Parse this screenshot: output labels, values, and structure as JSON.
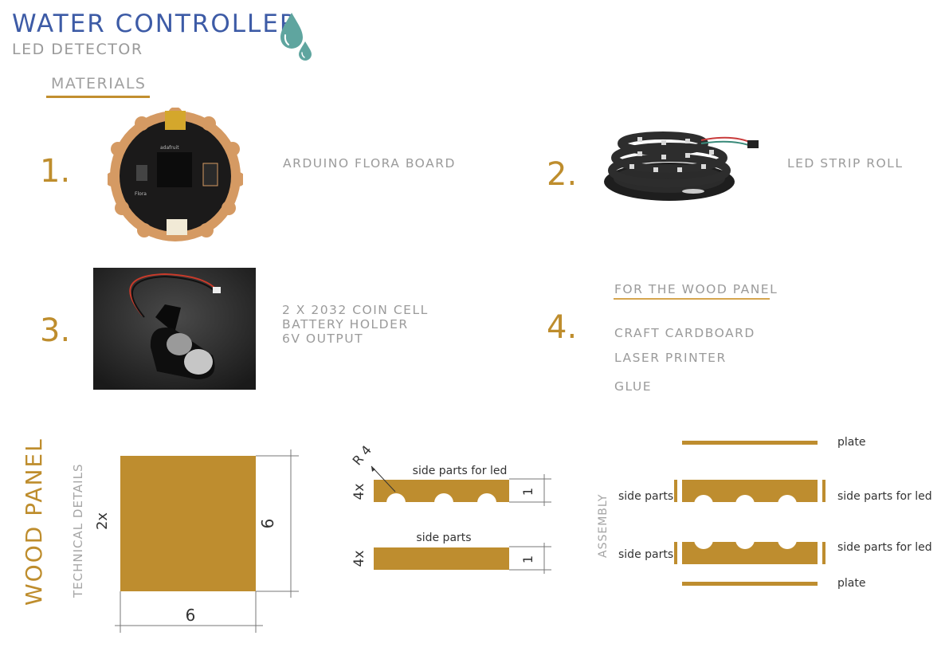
{
  "header": {
    "title": "WATER CONTROLLER",
    "subtitle": "LED DETECTOR",
    "icon": "water-drops-icon",
    "title_color": "#3d5ba6",
    "icon_color": "#5fa59f"
  },
  "materials": {
    "heading": "MATERIALS",
    "items": [
      {
        "number": "1.",
        "label": "ARDUINO FLORA BOARD",
        "image": "arduino-flora-board"
      },
      {
        "number": "2.",
        "label": "LED STRIP ROLL",
        "image": "led-strip-roll"
      },
      {
        "number": "3.",
        "label_lines": [
          "2 X 2032 COIN CELL",
          "BATTERY HOLDER",
          "6V OUTPUT"
        ],
        "image": "coin-cell-battery-holder"
      },
      {
        "number": "4.",
        "subheading": "FOR THE WOOD PANEL",
        "list": [
          "CRAFT CARDBOARD",
          "LASER PRINTER",
          "GLUE"
        ]
      }
    ]
  },
  "wood_panel": {
    "title": "WOOD PANEL",
    "technical_title": "TECHNICAL DETAILS",
    "square_panel": {
      "quantity": "2x",
      "width": "6",
      "height": "6"
    },
    "led_side_part": {
      "quantity": "4x",
      "label": "side parts for led",
      "height": "1",
      "radius_label": "R 4",
      "holes": 3
    },
    "side_part": {
      "quantity": "4x",
      "label": "side parts",
      "height": "1"
    },
    "assembly": {
      "title": "ASSEMBLY",
      "labels": {
        "plate_top": "plate",
        "side_parts_1": "side parts",
        "side_parts_for_led_1": "side parts for led",
        "side_parts_2": "side parts",
        "side_parts_for_led_2": "side parts for led",
        "plate_bottom": "plate"
      }
    },
    "wood_color": "#be8d2f"
  }
}
